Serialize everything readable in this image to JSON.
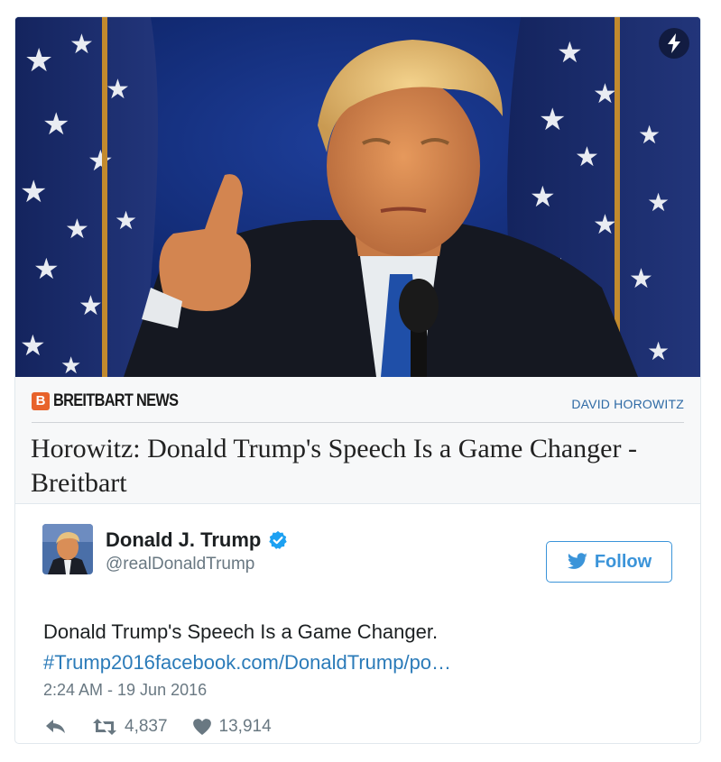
{
  "preview": {
    "publisher": "BREITBART NEWS",
    "publisher_logo_letter": "B",
    "author": "DAVID HOROWITZ",
    "headline": "Horowitz: Donald Trump's Speech Is a Game Changer - Breitbart"
  },
  "tweet": {
    "display_name": "Donald J. Trump",
    "handle": "@realDonaldTrump",
    "follow_label": "Follow",
    "text": "Donald Trump's Speech Is a Game Changer.",
    "link_text": "#Trump2016facebook.com/DonaldTrump/po…",
    "timestamp": "2:24 AM - 19 Jun 2016",
    "retweet_count": "4,837",
    "like_count": "13,914"
  },
  "colors": {
    "brand_accent": "#e8632b",
    "link_blue": "#2b7bb9",
    "follow_blue": "#3b94d9",
    "muted_gray": "#697882"
  },
  "icons": [
    "lightning-icon",
    "verified-badge-icon",
    "twitter-bird-icon",
    "reply-icon",
    "retweet-icon",
    "heart-icon"
  ]
}
